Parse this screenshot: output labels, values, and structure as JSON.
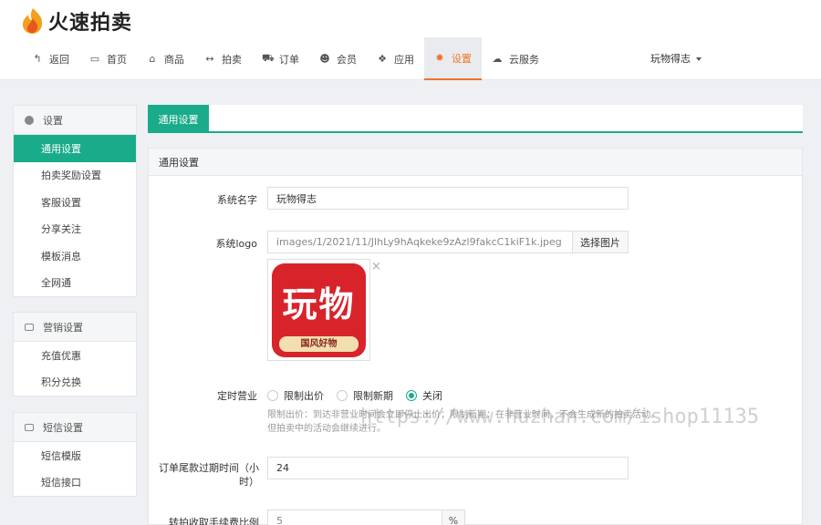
{
  "app": {
    "title": "火速拍卖"
  },
  "nav": [
    {
      "label": "返回",
      "icon": "back-icon",
      "glyph": "↰"
    },
    {
      "label": "首页",
      "icon": "monitor-icon",
      "glyph": "▭"
    },
    {
      "label": "商品",
      "icon": "gift-icon",
      "glyph": "⌂"
    },
    {
      "label": "拍卖",
      "icon": "arrows-icon",
      "glyph": "↔"
    },
    {
      "label": "订单",
      "icon": "cart-icon",
      "glyph": "⛟"
    },
    {
      "label": "会员",
      "icon": "users-icon",
      "glyph": "☻"
    },
    {
      "label": "应用",
      "icon": "cubes-icon",
      "glyph": "❖"
    },
    {
      "label": "设置",
      "icon": "gear-icon",
      "glyph": "✹"
    },
    {
      "label": "云服务",
      "icon": "cloud-icon",
      "glyph": "☁"
    }
  ],
  "user": {
    "name": "玩物得志"
  },
  "sidebar": {
    "groups": [
      {
        "title": "设置",
        "items": [
          "通用设置",
          "拍卖奖励设置",
          "客服设置",
          "分享关注",
          "模板消息",
          "全网通"
        ]
      },
      {
        "title": "营销设置",
        "items": [
          "充值优惠",
          "积分兑换"
        ]
      },
      {
        "title": "短信设置",
        "items": [
          "短信模版",
          "短信接口"
        ]
      }
    ]
  },
  "tabs": {
    "active": "通用设置"
  },
  "panel": {
    "title": "通用设置",
    "system_name_label": "系统名字",
    "system_name_value": "玩物得志",
    "logo_label": "系统logo",
    "logo_path": "images/1/2021/11/JlhLy9hAqkeke9zAzl9fakcC1kiF1k.jpeg",
    "choose_image": "选择图片",
    "logo_image_text": "玩物",
    "logo_image_band": "国风好物",
    "timer_label": "定时营业",
    "timer_options": [
      "限制出价",
      "限制新期",
      "关闭"
    ],
    "timer_selected": "关闭",
    "help_line1": "限制出价：到达非营业时间会立即停止出价；限制新期：在非营业时间，不会生成新的拍卖活动。",
    "help_line2": "但拍卖中的活动会继续进行。",
    "order_expire_label_1": "订单尾款过期时间（小",
    "order_expire_label_2": "时）",
    "order_expire_value": "24",
    "fee_label": "转拍收取手续费比例",
    "fee_value": "5",
    "fee_unit": "%"
  },
  "watermark": "https://www.huzhan.com/ishop11135",
  "colors": {
    "accent": "#1aab8b",
    "nav_active": "#f0732b"
  }
}
